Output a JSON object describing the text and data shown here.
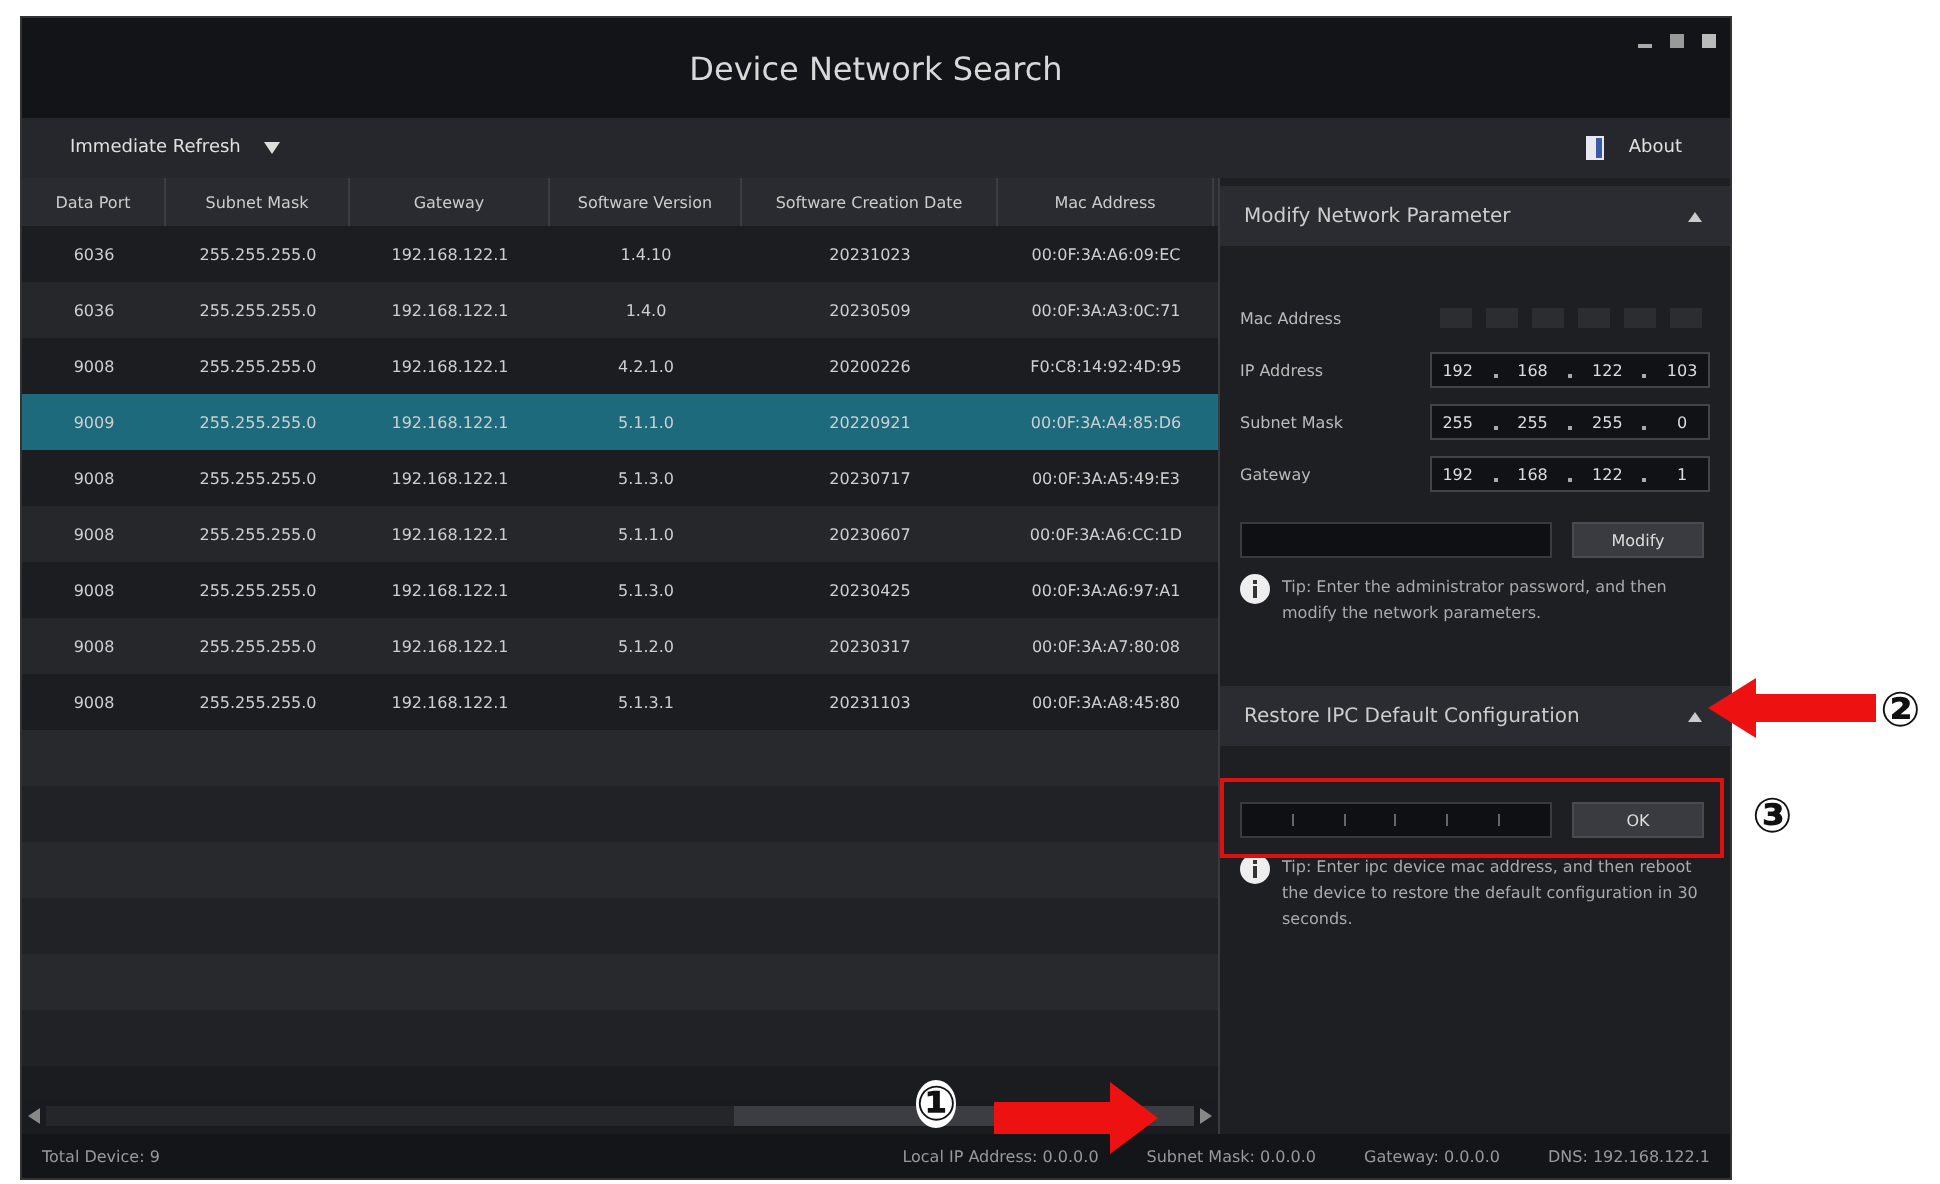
{
  "window": {
    "title": "Device Network Search"
  },
  "toolbar": {
    "refresh_button": "Immediate Refresh",
    "about_button": "About"
  },
  "table": {
    "columns": [
      "Data Port",
      "Subnet Mask",
      "Gateway",
      "Software Version",
      "Software Creation Date",
      "Mac Address"
    ],
    "rows": [
      {
        "selected": false,
        "cells": [
          "6036",
          "255.255.255.0",
          "192.168.122.1",
          "1.4.10",
          "20231023",
          "00:0F:3A:A6:09:EC"
        ]
      },
      {
        "selected": false,
        "cells": [
          "6036",
          "255.255.255.0",
          "192.168.122.1",
          "1.4.0",
          "20230509",
          "00:0F:3A:A3:0C:71"
        ]
      },
      {
        "selected": false,
        "cells": [
          "9008",
          "255.255.255.0",
          "192.168.122.1",
          "4.2.1.0",
          "20200226",
          "F0:C8:14:92:4D:95"
        ]
      },
      {
        "selected": true,
        "cells": [
          "9009",
          "255.255.255.0",
          "192.168.122.1",
          "5.1.1.0",
          "20220921",
          "00:0F:3A:A4:85:D6"
        ]
      },
      {
        "selected": false,
        "cells": [
          "9008",
          "255.255.255.0",
          "192.168.122.1",
          "5.1.3.0",
          "20230717",
          "00:0F:3A:A5:49:E3"
        ]
      },
      {
        "selected": false,
        "cells": [
          "9008",
          "255.255.255.0",
          "192.168.122.1",
          "5.1.1.0",
          "20230607",
          "00:0F:3A:A6:CC:1D"
        ]
      },
      {
        "selected": false,
        "cells": [
          "9008",
          "255.255.255.0",
          "192.168.122.1",
          "5.1.3.0",
          "20230425",
          "00:0F:3A:A6:97:A1"
        ]
      },
      {
        "selected": false,
        "cells": [
          "9008",
          "255.255.255.0",
          "192.168.122.1",
          "5.1.2.0",
          "20230317",
          "00:0F:3A:A7:80:08"
        ]
      },
      {
        "selected": false,
        "cells": [
          "9008",
          "255.255.255.0",
          "192.168.122.1",
          "5.1.3.1",
          "20231103",
          "00:0F:3A:A8:45:80"
        ]
      }
    ]
  },
  "modify_panel": {
    "title": "Modify Network Parameter",
    "expanded": true,
    "fields": [
      {
        "label": "Mac Address",
        "disabled": true
      },
      {
        "label": "IP Address",
        "disabled": false,
        "segments": [
          "192",
          "168",
          "122",
          "103"
        ]
      },
      {
        "label": "Subnet Mask",
        "disabled": false,
        "segments": [
          "255",
          "255",
          "255",
          "0"
        ]
      },
      {
        "label": "Gateway",
        "disabled": false,
        "segments": [
          "192",
          "168",
          "122",
          "1"
        ]
      }
    ],
    "button": "Modify",
    "tip": "Tip: Enter the administrator password, and then modify the network parameters."
  },
  "restore_panel": {
    "title": "Restore IPC Default Configuration",
    "expanded": true,
    "button": "OK",
    "tip": "Tip: Enter ipc device mac address, and then reboot the device to restore the default configuration in 30 seconds."
  },
  "status_bar": [
    "Total Device: 9",
    "Local IP Address: 0.0.0.0",
    "Subnet Mask: 0.0.0.0",
    "Gateway: 0.0.0.0",
    "DNS: 192.168.122.1"
  ],
  "annotations": [
    "①",
    "②",
    "③"
  ]
}
